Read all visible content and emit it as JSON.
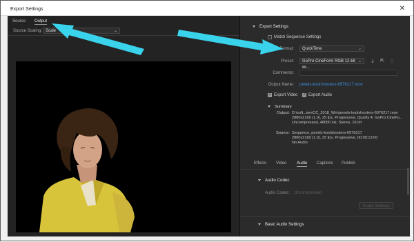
{
  "window": {
    "title": "Export Settings",
    "close_glyph": "✕"
  },
  "left_panel": {
    "tabs": [
      {
        "label": "Source"
      },
      {
        "label": "Output"
      }
    ],
    "source_scaling_label": "Source Scaling:",
    "source_scaling_value": "Scale"
  },
  "export_settings": {
    "header": "Export Settings",
    "match_sequence_label": "Match Sequence Settings",
    "format_label": "Format:",
    "format_value": "QuickTime",
    "preset_label": "Preset:",
    "preset_value": "GoPro CineForm RGB 12-bit wi...",
    "comments_label": "Comments:",
    "output_name_label": "Output Name:",
    "output_name_value": "pexels-koolshooters-6976217.mov",
    "export_video_label": "Export Video",
    "export_audio_label": "Export Audio",
    "export_video_checked": true,
    "export_audio_checked": true,
    "match_sequence_checked": false
  },
  "summary": {
    "header": "Summary",
    "output_label": "Output:",
    "output_lines": [
      "D:\\soft...iereCC_2018_Win\\pexels-koolshooters-6976217.mov",
      "2880x2160 (1.0), 25 fps, Progressive, Quality 4, GoPro CineFo...",
      "Uncompressed, 48000 Hz, Stereo, 16 bit"
    ],
    "source_label": "Source:",
    "source_lines": [
      "Sequence, pexels-koolshooters-6976217",
      "2880x2160 (1.0), 25 fps, Progressive, 00:00:13:00",
      "No Audio"
    ]
  },
  "sub_tabs": [
    {
      "label": "Effects"
    },
    {
      "label": "Video"
    },
    {
      "label": "Audio"
    },
    {
      "label": "Captions"
    },
    {
      "label": "Publish"
    }
  ],
  "audio_codec": {
    "header": "Audio Codec",
    "codec_label": "Audio Codec:",
    "codec_value": "Uncompressed",
    "codec_settings_button": "Codec Settings"
  },
  "basic_audio": {
    "header": "Basic Audio Settings"
  },
  "icons": {
    "save_preset": "download-icon",
    "import_preset": "import-icon",
    "delete_preset": "trash-icon",
    "arrow_color": "#3ad3ec"
  }
}
